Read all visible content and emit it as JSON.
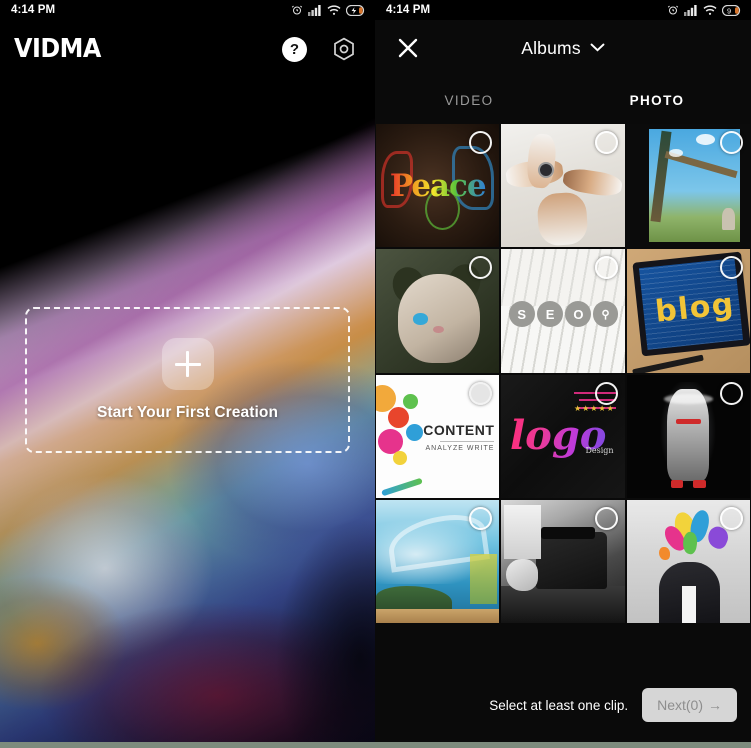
{
  "status_bar": {
    "time": "4:14 PM",
    "icons": [
      "alarm-icon",
      "signal-icon",
      "wifi-icon",
      "battery-charging-icon"
    ],
    "battery_level": "9"
  },
  "left_panel": {
    "app_name": "VIDMA",
    "help_icon_label": "?",
    "settings_icon_label": "gear-icon",
    "empty_state": {
      "plus_label": "+",
      "title": "Start Your First Creation"
    }
  },
  "right_panel": {
    "header": {
      "close_label": "✕",
      "album_title": "Albums",
      "chevron": "chevron-down-icon"
    },
    "tabs": [
      {
        "label": "VIDEO",
        "active": false
      },
      {
        "label": "PHOTO",
        "active": true
      }
    ],
    "grid": {
      "columns": 3,
      "items": [
        {
          "name": "peace-graffiti-art",
          "caption": "Peace",
          "selected": false
        },
        {
          "name": "hands-together-team",
          "caption": "",
          "selected": false
        },
        {
          "name": "blue-sky-landscape",
          "caption": "",
          "selected": false
        },
        {
          "name": "siamese-cat",
          "caption": "",
          "selected": false
        },
        {
          "name": "seo-blocks-keyboard",
          "caption": "SEO",
          "selected": false
        },
        {
          "name": "blog-tablet",
          "caption": "blog",
          "selected": false
        },
        {
          "name": "content-infographic",
          "caption": "CONTENT",
          "caption_sub": "ANALYZE   WRITE",
          "selected": false
        },
        {
          "name": "logo-design-art",
          "caption": "logo",
          "caption_sub": "Design",
          "selected": false
        },
        {
          "name": "superhero-figure",
          "caption": "",
          "selected": false
        },
        {
          "name": "ocean-wave-painting",
          "caption": "",
          "selected": false
        },
        {
          "name": "vintage-typewriter",
          "caption": "",
          "selected": false
        },
        {
          "name": "creative-mind-explosion",
          "caption": "",
          "selected": false
        }
      ]
    },
    "footer": {
      "hint": "Select at least one clip.",
      "next_label": "Next(0)",
      "next_arrow": "→",
      "next_enabled": false
    }
  },
  "colors": {
    "background": "#000000",
    "panel": "#0a0a0a",
    "text_primary": "#ffffff",
    "text_muted": "#9a9a9a",
    "next_button_bg": "#d6d6d6",
    "next_button_text": "#8e8e8e",
    "bottom_strip": "#7d8b7d"
  }
}
